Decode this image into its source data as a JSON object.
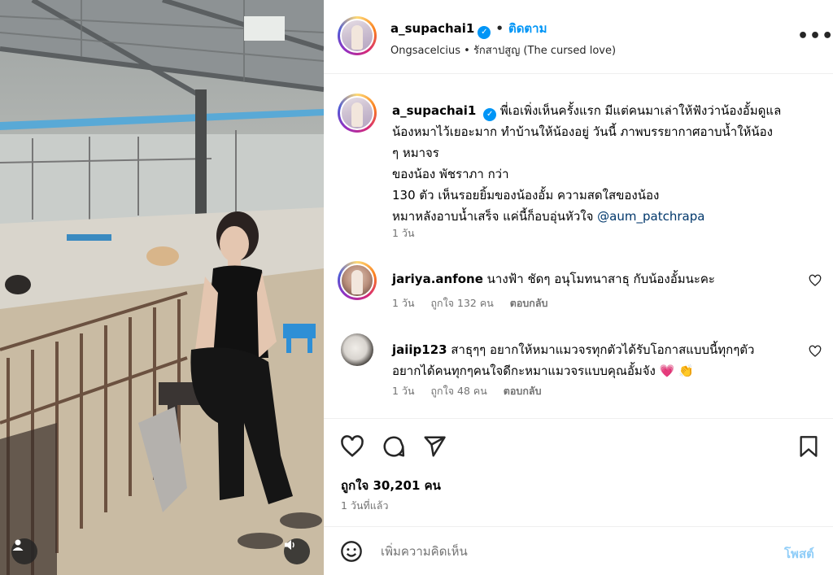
{
  "header": {
    "username": "a_supachai1",
    "follow_label": "ติดตาม",
    "dot": "•",
    "location": "Ongsacelcius",
    "audio": "รักสาปสูญ (The cursed love)",
    "more": "•••"
  },
  "caption": {
    "username": "a_supachai1",
    "lines": [
      "พี่เอเพิ่งเห็นครั้งแรก มีแต่คนมาเล่าให้ฟังว่าน้องอั้มดูแล",
      "น้องหมาไว้เยอะมาก ทำบ้านให้น้องอยู่ วันนี้ ภาพบรรยากาศอาบน้ำให้น้อง",
      "ๆ หมาจร",
      "ของน้อง พัชราภา กว่า",
      "130 ตัว เห็นรอยยิ้มของน้องอั้ม ความสดใสของน้อง",
      "หมาหลังอาบน้ำเสร็จ แค่นี้ก็อบอุ่นหัวใจ"
    ],
    "mention": "@aum_patchrapa",
    "time": "1 วัน"
  },
  "comments": [
    {
      "username": "jariya.anfone",
      "lines": [
        "นางฟ้า ชัดๆ อนุโมทนาสาธุ กับน้องอั้มนะคะ"
      ],
      "time": "1 วัน",
      "likes": "ถูกใจ 132 คน",
      "reply": "ตอบกลับ"
    },
    {
      "username": "jaiip123",
      "lines": [
        "สาธุๆๆ อยากให้หมาแมวจรทุกตัวได้รับโอกาสแบบนี้ทุกๆตัว",
        "อยากได้คนทุกๆคนใจดีกะหมาแมวจรแบบคุณอั้มจัง 💗 👏"
      ],
      "time": "1 วัน",
      "likes": "ถูกใจ 48 คน",
      "reply": "ตอบกลับ"
    }
  ],
  "actions": {
    "likes_text": "ถูกใจ 30,201 คน",
    "date": "1 วันที่แล้ว"
  },
  "comment_box": {
    "placeholder": "เพิ่มความคิดเห็น",
    "post_label": "โพสต์"
  },
  "colors": {
    "accent": "#0095f6",
    "mention": "#00376b",
    "muted": "#737373",
    "post_disabled": "#8fcdf8"
  },
  "icons": [
    "verified-badge-icon",
    "more-options-icon",
    "heart-icon",
    "comment-icon",
    "share-icon",
    "bookmark-icon",
    "emoji-icon",
    "user-tag-icon",
    "speaker-icon"
  ]
}
